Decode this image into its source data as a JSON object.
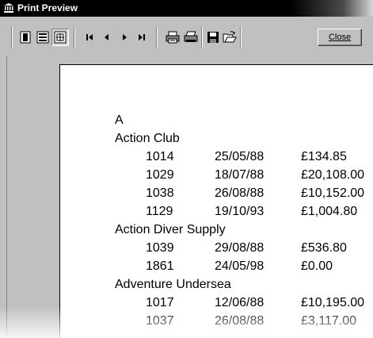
{
  "window": {
    "title": "Print Preview"
  },
  "toolbar": {
    "buttons": [
      {
        "name": "one-page-icon"
      },
      {
        "name": "two-page-icon"
      },
      {
        "name": "zoom-fit-icon"
      },
      {
        "name": "first-page-icon"
      },
      {
        "name": "previous-page-icon"
      },
      {
        "name": "next-page-icon"
      },
      {
        "name": "last-page-icon"
      },
      {
        "name": "print-setup-icon"
      },
      {
        "name": "print-icon"
      },
      {
        "name": "save-icon"
      },
      {
        "name": "open-icon"
      }
    ],
    "close_label": "Close"
  },
  "report": {
    "group_letter": "A",
    "customers": [
      {
        "name": "Action Club",
        "rows": [
          {
            "id": "1014",
            "date": "25/05/88",
            "amount": "£134.85"
          },
          {
            "id": "1029",
            "date": "18/07/88",
            "amount": "£20,108.00"
          },
          {
            "id": "1038",
            "date": "26/08/88",
            "amount": "£10,152.00"
          },
          {
            "id": "1129",
            "date": "19/10/93",
            "amount": "£1,004.80"
          }
        ]
      },
      {
        "name": "Action Diver Supply",
        "rows": [
          {
            "id": "1039",
            "date": "29/08/88",
            "amount": "£536.80"
          },
          {
            "id": "1861",
            "date": "24/05/98",
            "amount": "£0.00"
          }
        ]
      },
      {
        "name": "Adventure Undersea",
        "rows": [
          {
            "id": "1017",
            "date": "12/06/88",
            "amount": "£10,195.00"
          },
          {
            "id": "1037",
            "date": "26/08/88",
            "amount": "£3,117.00"
          }
        ]
      }
    ]
  }
}
